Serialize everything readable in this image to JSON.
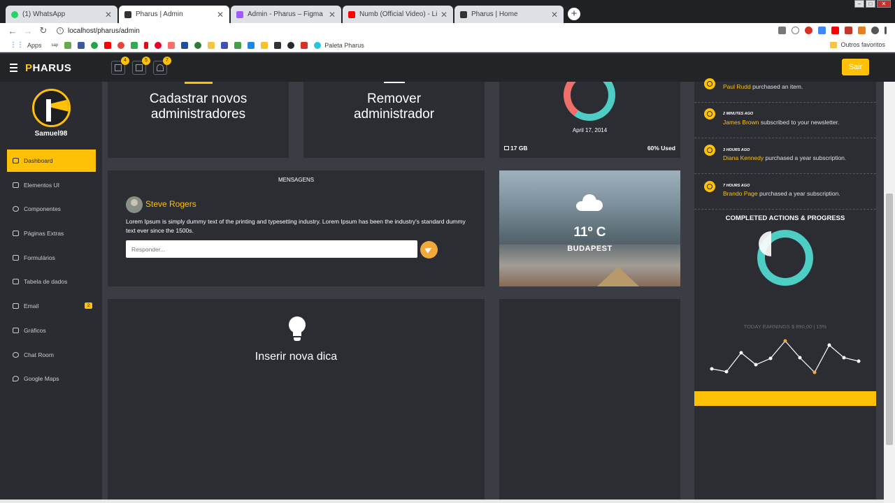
{
  "browser": {
    "tabs": [
      {
        "title": "(1) WhatsApp",
        "color": "#25d366"
      },
      {
        "title": "Pharus | Admin",
        "color": "#333333"
      },
      {
        "title": "Admin - Pharus – Figma",
        "color": "#a259ff"
      },
      {
        "title": "Numb (Official Video) - Linkin Pa",
        "color": "#ff0000"
      },
      {
        "title": "Pharus | Home",
        "color": "#333333"
      }
    ],
    "url": "localhost/pharus/admin",
    "bookmarks": {
      "apps": "Apps",
      "sap": "sap",
      "paleta": "Paleta Pharus",
      "others": "Outros favoritos"
    }
  },
  "header": {
    "brand_first": "P",
    "brand_rest": "HARUS",
    "badges": [
      "4",
      "5",
      "7"
    ],
    "logout": "Sair"
  },
  "sidebar": {
    "username": "Samuel98",
    "items": [
      {
        "label": "Dashboard"
      },
      {
        "label": "Elementos UI"
      },
      {
        "label": "Componentes"
      },
      {
        "label": "Páginas Extras"
      },
      {
        "label": "Formulários"
      },
      {
        "label": "Tabela de dados"
      },
      {
        "label": "Email",
        "badge": "2"
      },
      {
        "label": "Gráficos"
      },
      {
        "label": "Chat Room"
      },
      {
        "label": "Google Maps"
      }
    ]
  },
  "cards": {
    "add_admin": "Cadastrar novos administradores",
    "remove_admin": "Remover administrador",
    "storage": {
      "date": "April 17, 2014",
      "size": "17 GB",
      "used": "60% Used",
      "used_fraction": 0.6
    },
    "messages": {
      "title": "MENSAGENS",
      "author": "Steve Rogers",
      "text": "Lorem Ipsum is simply dummy text of the printing and typesetting industry. Lorem Ipsum has been the industry's standard dummy text ever since the 1500s.",
      "placeholder": "Responder..."
    },
    "weather": {
      "temp": "11º C",
      "city": "BUDAPEST"
    },
    "tip": "Inserir nova dica"
  },
  "feed": {
    "items": [
      {
        "time": "",
        "name": "Paul Rudd",
        "action": " purchased an item."
      },
      {
        "time": "2 MINUTES AGO",
        "name": "James Brown",
        "action": " subscribed to your newsletter."
      },
      {
        "time": "3 HOURS AGO",
        "name": "Diana Kennedy",
        "action": " purchased a year subscription."
      },
      {
        "time": "7 HOURS AGO",
        "name": "Brando Page",
        "action": " purchased a year subscription."
      }
    ],
    "progress_title": "COMPLETED ACTIONS & PROGRESS",
    "earnings": "TODAY EARNINGS $ 890,00 | 15%"
  },
  "colors": {
    "accent": "#ffc107",
    "teal": "#4ecdc4",
    "coral": "#f06f6a"
  }
}
